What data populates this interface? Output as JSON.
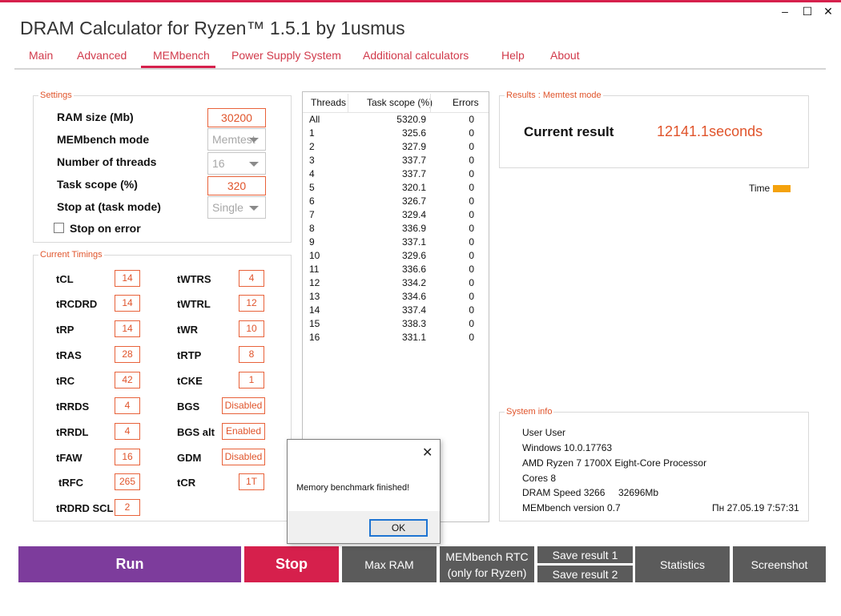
{
  "window": {
    "title": "DRAM Calculator for Ryzen™ 1.5.1 by 1usmus",
    "minimize": "–",
    "maximize": "☐",
    "close": "✕"
  },
  "tabs": [
    {
      "label": "Main"
    },
    {
      "label": "Advanced"
    },
    {
      "label": "MEMbench",
      "active": true
    },
    {
      "label": "Power Supply System"
    },
    {
      "label": "Additional calculators"
    },
    {
      "label": "Help"
    },
    {
      "label": "About"
    }
  ],
  "settings": {
    "title": "Settings",
    "ram_size_label": "RAM size (Mb)",
    "ram_size_value": "30200",
    "mode_label": "MEMbench mode",
    "mode_value": "Memtest",
    "threads_label": "Number of threads",
    "threads_value": "16",
    "task_scope_label": "Task scope (%)",
    "task_scope_value": "320",
    "stop_at_label": "Stop at (task mode)",
    "stop_at_value": "Single",
    "stop_on_error_label": "Stop on error",
    "stop_on_error_checked": false
  },
  "timings": {
    "title": "Current Timings",
    "left": [
      {
        "label": "tCL",
        "value": "14"
      },
      {
        "label": "tRCDRD",
        "value": "14"
      },
      {
        "label": "tRP",
        "value": "14"
      },
      {
        "label": "tRAS",
        "value": "28"
      },
      {
        "label": "tRC",
        "value": "42"
      },
      {
        "label": "tRRDS",
        "value": "4"
      },
      {
        "label": "tRRDL",
        "value": "4"
      },
      {
        "label": "tFAW",
        "value": "16"
      },
      {
        "label": "tRFC",
        "value": "265"
      },
      {
        "label": "tRDRD SCL",
        "value": "2"
      }
    ],
    "right": [
      {
        "label": "tWTRS",
        "value": "4"
      },
      {
        "label": "tWTRL",
        "value": "12"
      },
      {
        "label": "tWR",
        "value": "10"
      },
      {
        "label": "tRTP",
        "value": "8"
      },
      {
        "label": "tCKE",
        "value": "1"
      },
      {
        "label": "BGS",
        "value": "Disabled"
      },
      {
        "label": "BGS alt",
        "value": "Enabled"
      },
      {
        "label": "GDM",
        "value": "Disabled"
      },
      {
        "label": "tCR",
        "value": "1T"
      }
    ]
  },
  "threads_table": {
    "headers": [
      "Threads",
      "Task scope (%)",
      "Errors"
    ],
    "rows": [
      [
        "All",
        "5320.9",
        "0"
      ],
      [
        "1",
        "325.6",
        "0"
      ],
      [
        "2",
        "327.9",
        "0"
      ],
      [
        "3",
        "337.7",
        "0"
      ],
      [
        "4",
        "337.7",
        "0"
      ],
      [
        "5",
        "320.1",
        "0"
      ],
      [
        "6",
        "326.7",
        "0"
      ],
      [
        "7",
        "329.4",
        "0"
      ],
      [
        "8",
        "336.9",
        "0"
      ],
      [
        "9",
        "337.1",
        "0"
      ],
      [
        "10",
        "329.6",
        "0"
      ],
      [
        "11",
        "336.6",
        "0"
      ],
      [
        "12",
        "334.2",
        "0"
      ],
      [
        "13",
        "334.6",
        "0"
      ],
      [
        "14",
        "337.4",
        "0"
      ],
      [
        "15",
        "338.3",
        "0"
      ],
      [
        "16",
        "331.1",
        "0"
      ]
    ]
  },
  "results": {
    "title": "Results : Memtest mode",
    "label": "Current result",
    "value": "12141.1",
    "unit": "seconds",
    "legend_label": "Time",
    "legend_color": "#f4a20d"
  },
  "system_info": {
    "title": "System info",
    "user": "User User",
    "os": "Windows 10.0.17763",
    "cpu": "AMD Ryzen 7 1700X Eight-Core Processor",
    "cores": "Cores 8",
    "dram_speed": "DRAM Speed 3266",
    "memory": "32696Mb",
    "version": "MEMbench version 0.7",
    "datetime": "Пн 27.05.19 7:57:31"
  },
  "buttons": {
    "run": "Run",
    "stop": "Stop",
    "max_ram": "Max RAM",
    "rtc_line1": "MEMbench RTC",
    "rtc_line2": "(only for Ryzen)",
    "save1": "Save result 1",
    "save2": "Save result 2",
    "statistics": "Statistics",
    "screenshot": "Screenshot"
  },
  "dialog": {
    "message": "Memory benchmark finished!",
    "ok": "OK",
    "close": "✕"
  },
  "colors": {
    "accent": "#d6204c",
    "orange": "#e0542b",
    "run": "#7d3c9c",
    "button_gray": "#5b5b5b"
  }
}
